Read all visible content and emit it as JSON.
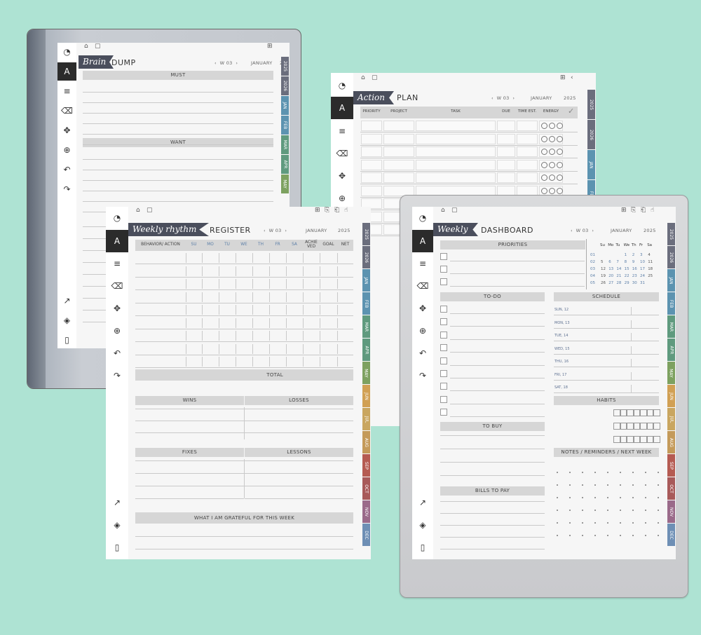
{
  "months": [
    "JAN",
    "FEB",
    "MAR",
    "APR",
    "MAY",
    "JUN",
    "JUL",
    "AUG",
    "SEP",
    "OCT",
    "NOV",
    "DEC"
  ],
  "years": [
    "2025",
    "2026"
  ],
  "nav": {
    "week": "W 03",
    "month": "JANUARY",
    "year": "2025"
  },
  "brain": {
    "ribbon": "Brain",
    "title": "DUMP",
    "must": "MUST",
    "want": "WANT",
    "tabs": [
      "2025",
      "2026",
      "JAN",
      "FEB",
      "MAR",
      "APR",
      "MAY"
    ]
  },
  "action": {
    "ribbon": "Action",
    "title": "PLAN",
    "cols": [
      "PRIORITY",
      "PROJECT",
      "TASK",
      "DUE",
      "TIME EST.",
      "ENERGY"
    ],
    "tabs": [
      "2025",
      "2026",
      "JAN",
      "FEB"
    ]
  },
  "register": {
    "ribbon": "Weekly rhythm",
    "title": "REGISTER",
    "cols": [
      "BEHAVIOR/ ACTION",
      "SU",
      "MO",
      "TU",
      "WE",
      "TH",
      "FR",
      "SA",
      "ACHIE VED",
      "GOAL",
      "NET"
    ],
    "total": "TOTAL",
    "wins": "WINS",
    "losses": "LOSSES",
    "fixes": "FIXES",
    "lessons": "LESSONS",
    "grateful": "WHAT I AM GRATEFUL FOR THIS WEEK"
  },
  "dashboard": {
    "ribbon": "Weekly",
    "title": "DASHBOARD",
    "priorities": "PRIORITIES",
    "todo": "TO-DO",
    "schedule": "SCHEDULE",
    "tobuy": "TO BUY",
    "habits": "HABITS",
    "notes": "NOTES / REMINDERS / NEXT WEEK",
    "bills": "BILLS TO PAY",
    "days": [
      "SUN, 12",
      "MON, 13",
      "TUE, 14",
      "WED, 15",
      "THU, 16",
      "FRI, 17",
      "SAT, 18"
    ],
    "calhead": [
      "Su",
      "Mo",
      "Tu",
      "We",
      "Th",
      "Fr",
      "Sa"
    ],
    "weeks": [
      "01",
      "02",
      "03",
      "04",
      "05"
    ],
    "cal": [
      [
        "",
        "",
        "",
        "1",
        "2",
        "3",
        "4"
      ],
      [
        "5",
        "6",
        "7",
        "8",
        "9",
        "10",
        "11"
      ],
      [
        "12",
        "13",
        "14",
        "15",
        "16",
        "17",
        "18"
      ],
      [
        "19",
        "20",
        "21",
        "22",
        "23",
        "24",
        "25"
      ],
      [
        "26",
        "27",
        "28",
        "29",
        "30",
        "31",
        ""
      ]
    ]
  },
  "colors": {
    "tabs": [
      "#6b6e7d",
      "#6b6e7d",
      "#5c93b0",
      "#5c93b0",
      "#5f9a7e",
      "#5f9a7e",
      "#7da160",
      "#d1a054",
      "#c9a660",
      "#c49a5a",
      "#b55b52",
      "#a85a5a",
      "#9a6a8a",
      "#6e8fb5"
    ]
  }
}
